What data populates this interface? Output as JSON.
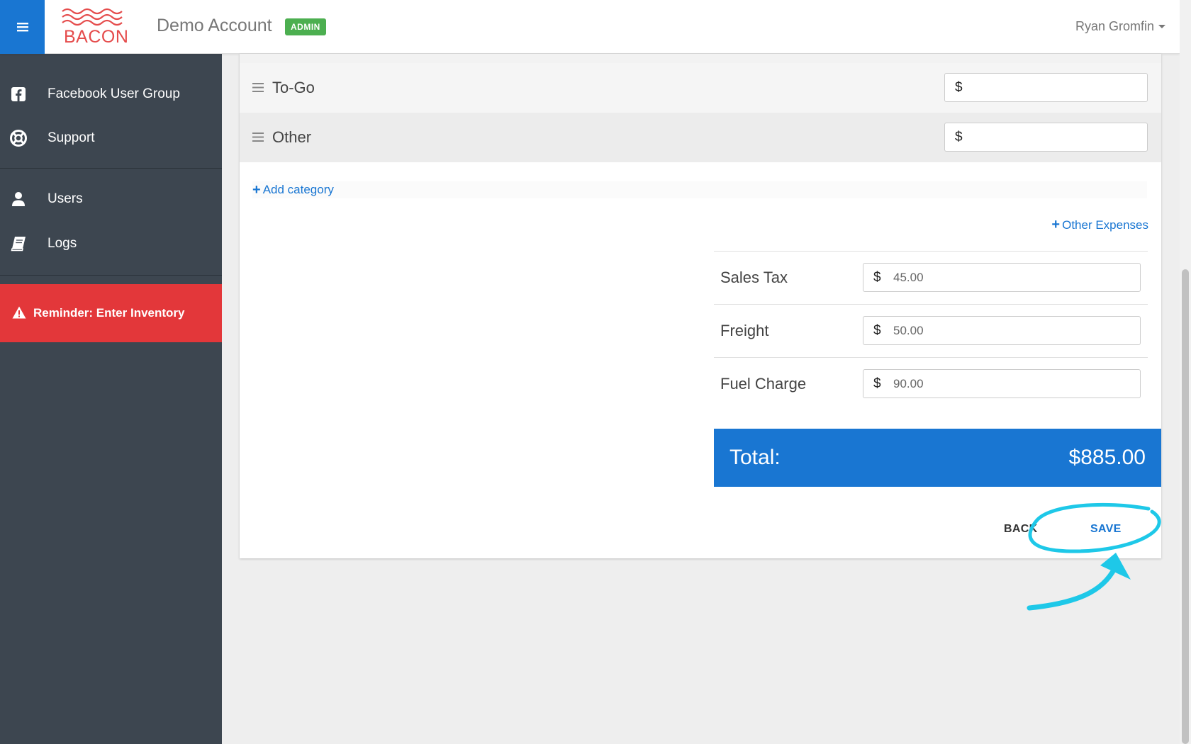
{
  "header": {
    "logo_text": "BACON",
    "account_name": "Demo Account",
    "role_badge": "ADMIN",
    "user_name": "Ryan Gromfin"
  },
  "sidebar": {
    "items": [
      {
        "label": "Facebook User Group",
        "icon": "facebook-icon"
      },
      {
        "label": "Support",
        "icon": "lifebuoy-icon"
      },
      {
        "label": "Users",
        "icon": "user-icon"
      },
      {
        "label": "Logs",
        "icon": "book-icon"
      }
    ],
    "reminder": "Reminder: Enter Inventory"
  },
  "categories": [
    {
      "name": "To-Go",
      "currency": "$",
      "value": ""
    },
    {
      "name": "Other",
      "currency": "$",
      "value": ""
    }
  ],
  "add_category_label": "Add category",
  "other_expenses_label": "Other Expenses",
  "expenses": [
    {
      "label": "Sales Tax",
      "currency": "$",
      "value": "45.00"
    },
    {
      "label": "Freight",
      "currency": "$",
      "value": "50.00"
    },
    {
      "label": "Fuel Charge",
      "currency": "$",
      "value": "90.00"
    }
  ],
  "total": {
    "label": "Total:",
    "value": "$885.00"
  },
  "actions": {
    "back": "BACK",
    "save": "SAVE"
  },
  "colors": {
    "primary": "#1976d2",
    "sidebar": "#3d4650",
    "reminder": "#e3373a",
    "badge": "#4caf50",
    "annotation": "#1ec8e8"
  }
}
